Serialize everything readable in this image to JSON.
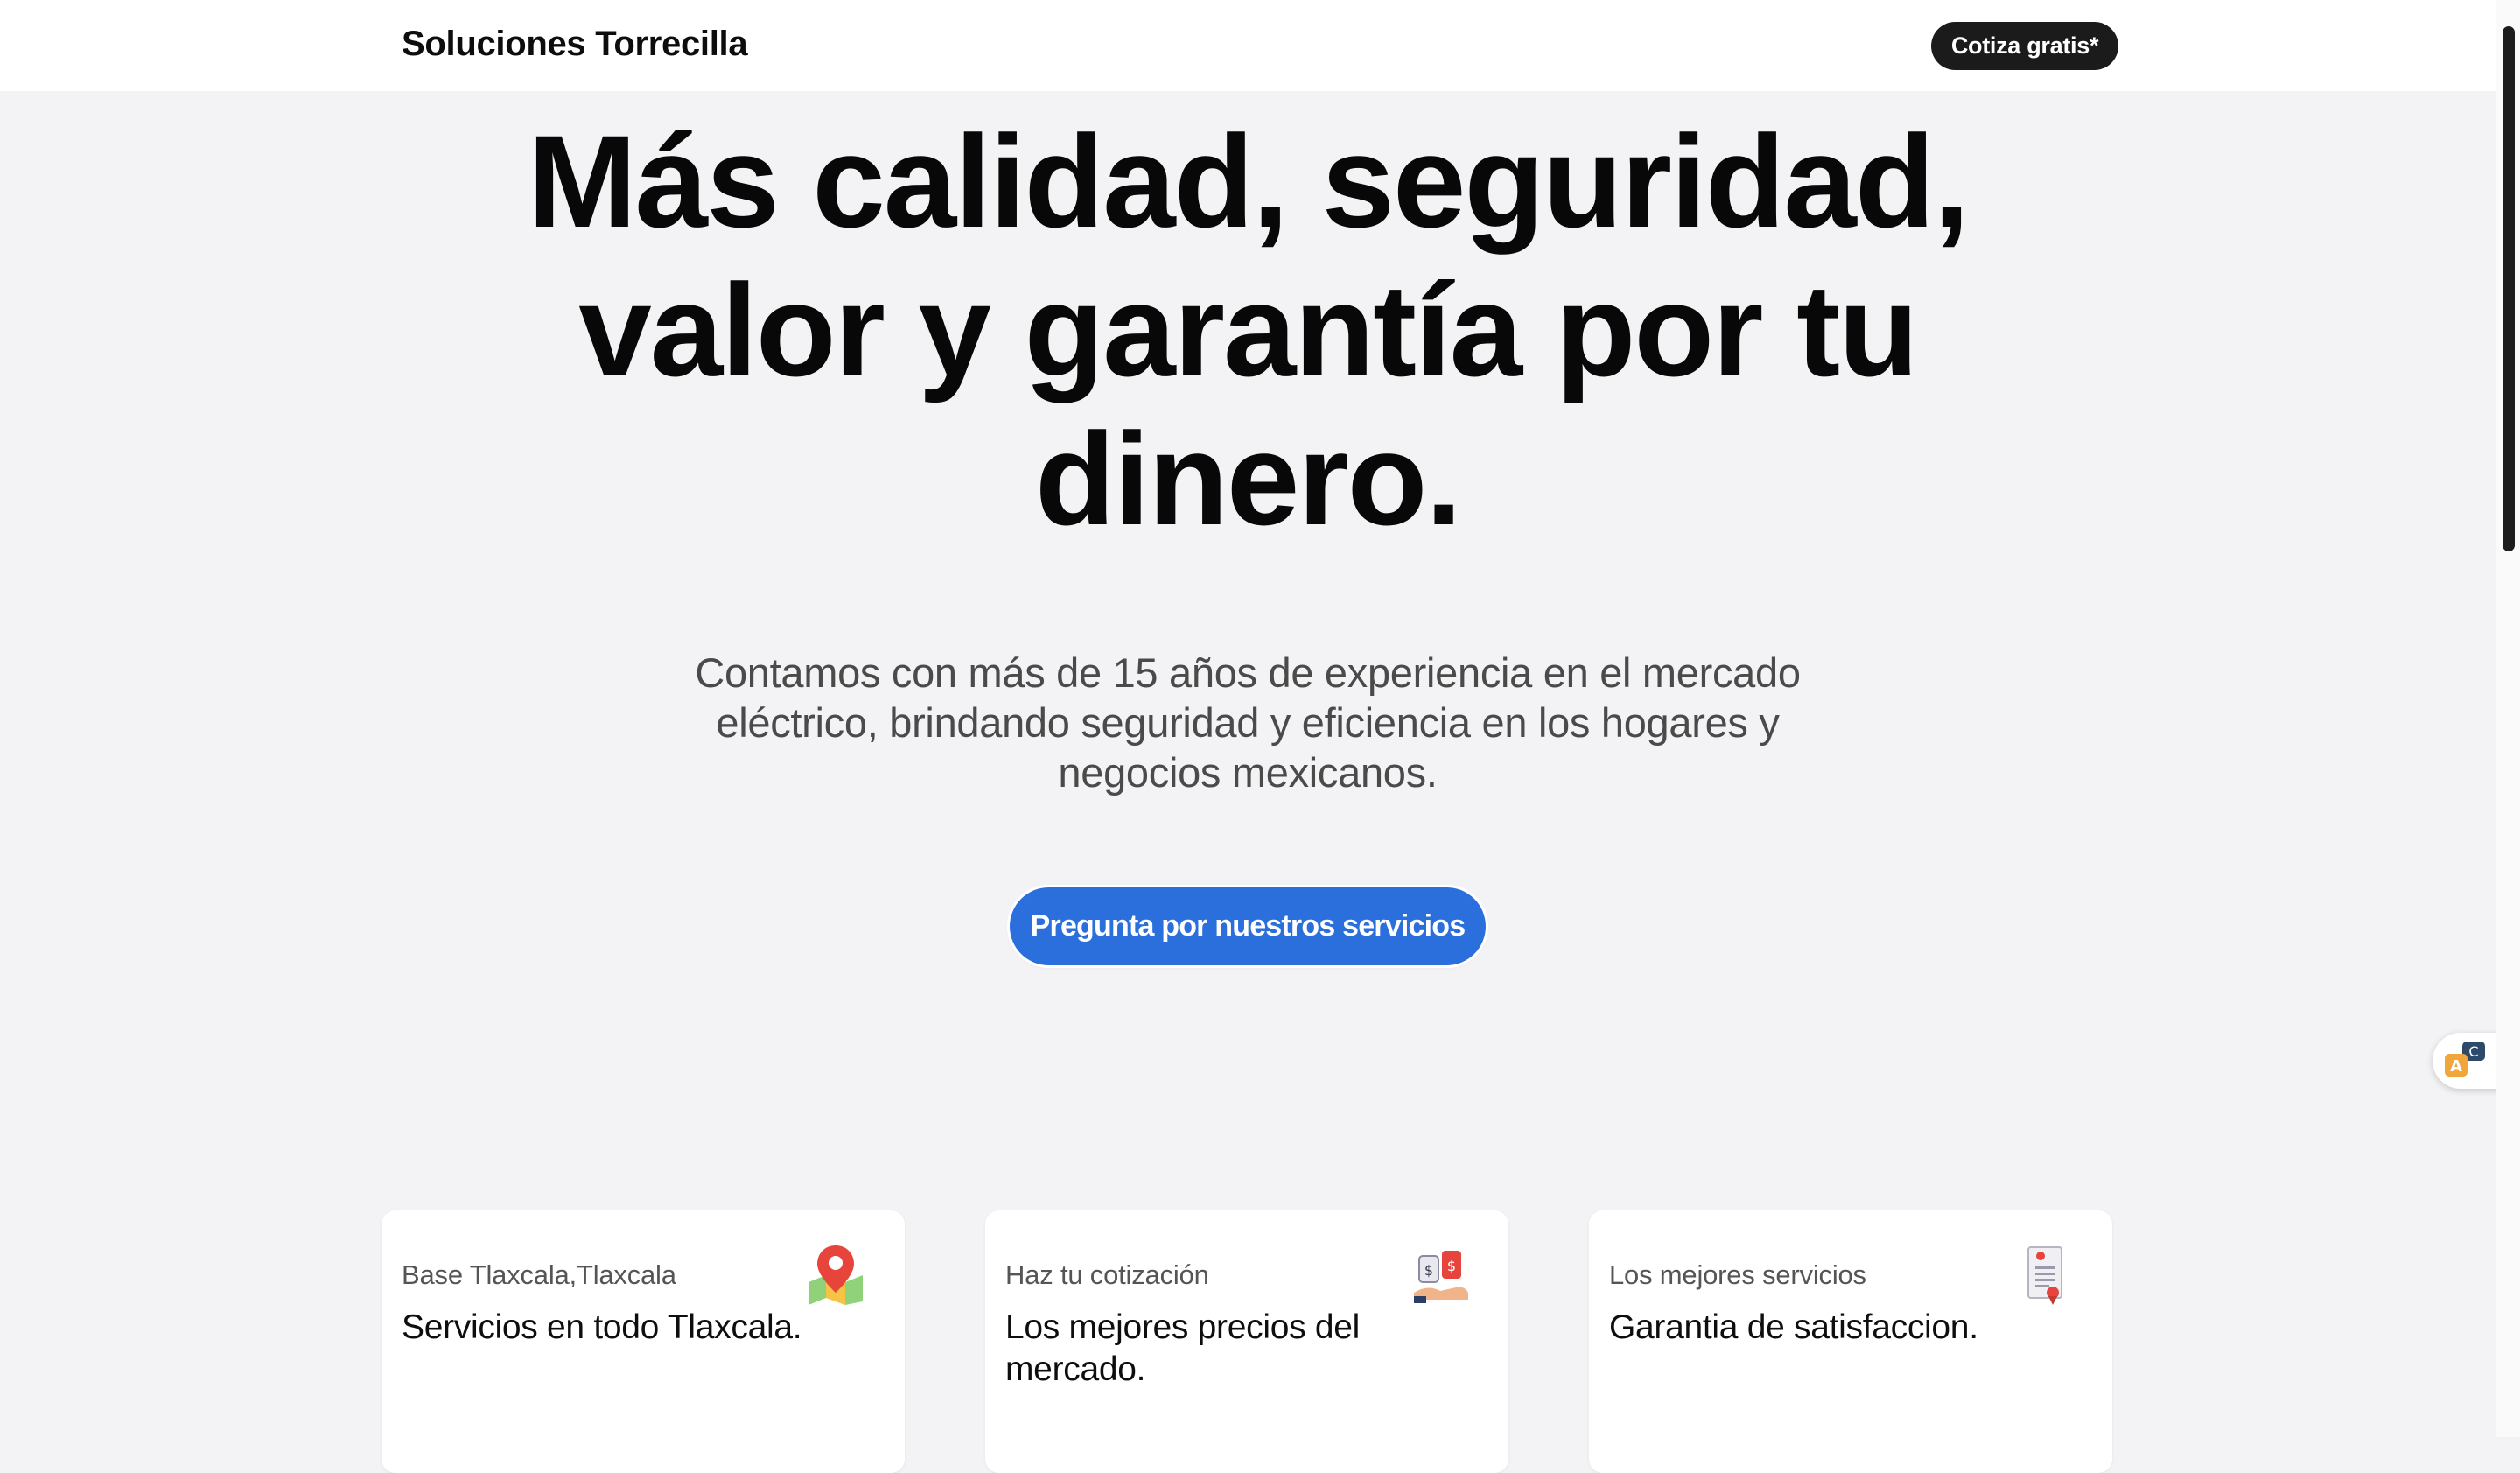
{
  "header": {
    "brand": "Soluciones Torrecilla",
    "quote_button": "Cotiza gratis*"
  },
  "hero": {
    "title": "Más calidad, seguridad, valor y garantía por tu dinero.",
    "subtitle": "Contamos con más de 15 años de experiencia en el mercado eléctrico, brindando seguridad y eficiencia en los hogares y negocios mexicanos.",
    "cta_label": "Pregunta por nuestros servicios"
  },
  "cards": [
    {
      "label": "Base Tlaxcala,Tlaxcala",
      "title": "Servicios en todo Tlaxcala.",
      "icon": "map-pin-icon"
    },
    {
      "label": "Haz tu cotización",
      "title": "Los mejores precios del mercado.",
      "icon": "price-tags-icon"
    },
    {
      "label": "Los mejores servicios",
      "title": "Garantia de satisfaccion.",
      "icon": "certificate-icon"
    }
  ],
  "widgets": {
    "translate": "translate-icon"
  },
  "colors": {
    "background": "#f3f3f5",
    "header_bg": "#ffffff",
    "primary_button": "#2a6fdb",
    "dark_button": "#1b1b1b",
    "text": "#080808",
    "muted_text": "#4a4a4a"
  }
}
